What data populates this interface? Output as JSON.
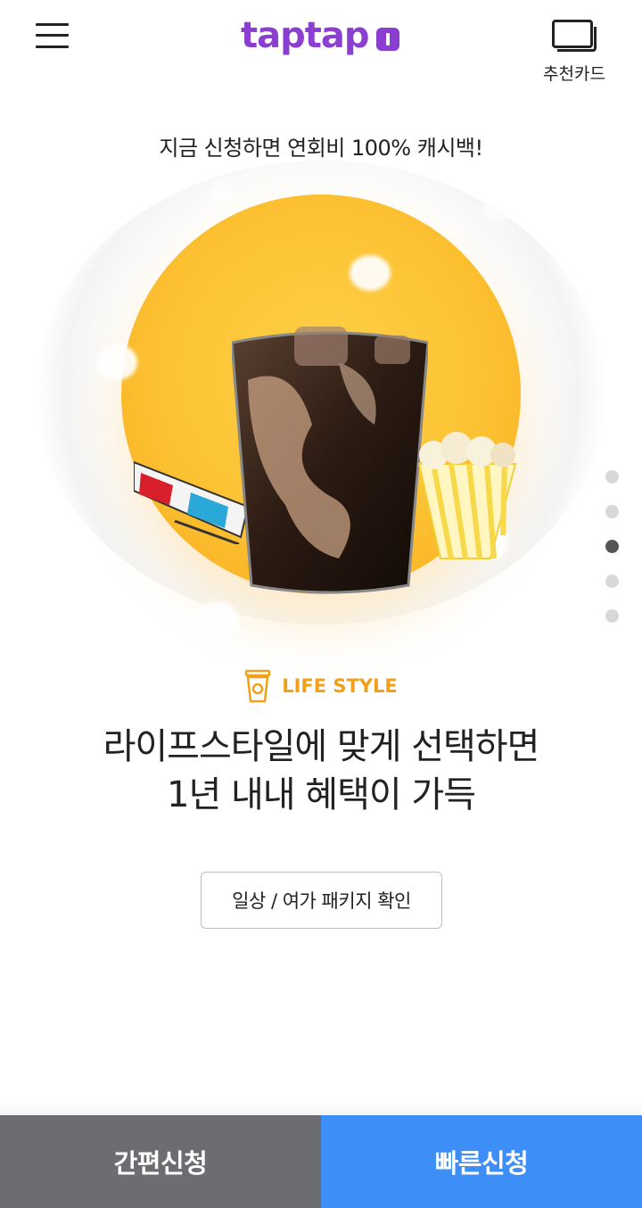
{
  "header": {
    "menu_icon": "hamburger-menu-icon",
    "logo_text": "taptap",
    "logo_icon": "taptap-i-chip",
    "logo_color": "#8b3fd0",
    "recommend_label": "추천카드",
    "recommend_icon": "cards-stack-icon"
  },
  "promo": {
    "text": "지금 신청하면 연회비 100% 캐시백!"
  },
  "hero": {
    "image_subject": "iced coffee, popcorn and 3D glasses on yellow circle",
    "accent_color": "#fcc233"
  },
  "pagination": {
    "total": 5,
    "active_index": 2
  },
  "category": {
    "icon": "coffee-cup-icon",
    "label": "LIFE STYLE",
    "color": "#f0a019"
  },
  "headline": {
    "line1": "라이프스타일에 맞게 선택하면",
    "line2": "1년 내내 혜택이 가득"
  },
  "package_button": {
    "label": "일상 / 여가 패키지 확인"
  },
  "bottom_bar": {
    "simple_label": "간편신청",
    "simple_color": "#6b6d70",
    "fast_label": "빠른신청",
    "fast_color": "#3e8ef7"
  }
}
